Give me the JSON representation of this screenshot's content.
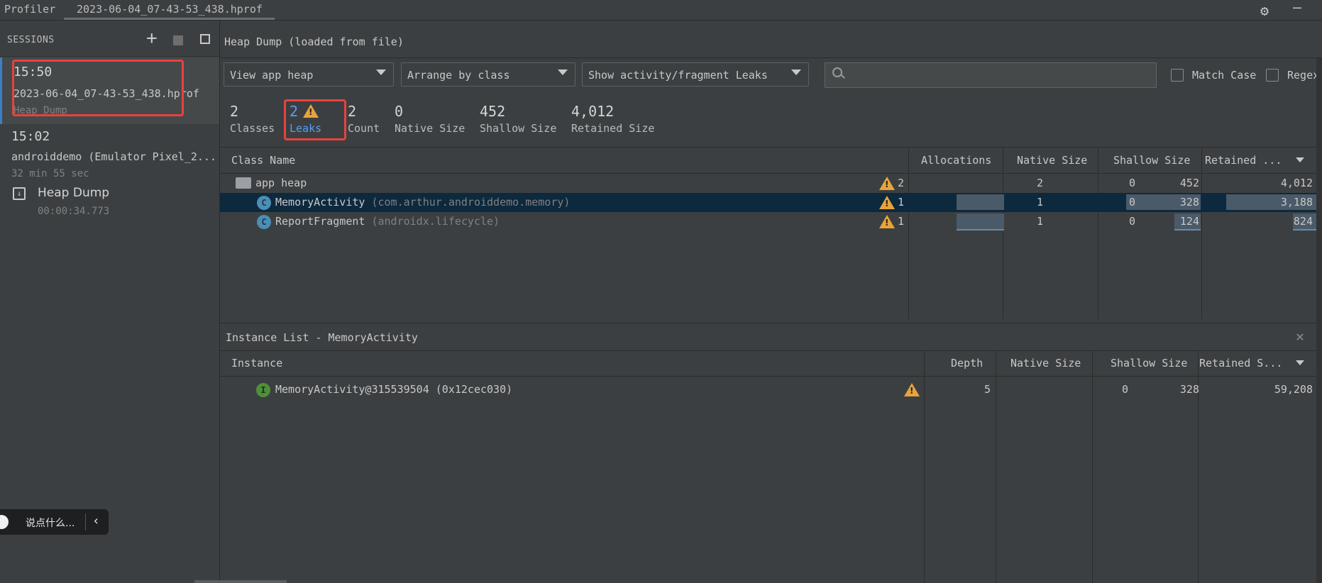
{
  "top_tabs": [
    "Profiler",
    "2023-06-04_07-43-53_438.hprof"
  ],
  "sessions": {
    "title": "SESSIONS",
    "items": [
      {
        "time": "15:50",
        "name": "2023-06-04_07-43-53_438.hprof",
        "type": "Heap Dump"
      },
      {
        "time": "15:02",
        "name": "androiddemo (Emulator Pixel_2...",
        "duration": "32 min 55 sec",
        "artifact": {
          "label": "Heap Dump",
          "time": "00:00:34.773"
        }
      }
    ]
  },
  "chat_pill": {
    "label": "说点什么..."
  },
  "main": {
    "title": "Heap Dump (loaded from file)",
    "dropdowns": {
      "heap": "View app heap",
      "arrange": "Arrange by class",
      "filter": "Show activity/fragment Leaks"
    },
    "search": {
      "placeholder": ""
    },
    "match_case": "Match Case",
    "regex": "Regex"
  },
  "stats": [
    {
      "value": "2",
      "label": "Classes"
    },
    {
      "value": "2",
      "label": "Leaks"
    },
    {
      "value": "2",
      "label": "Count"
    },
    {
      "value": "0",
      "label": "Native Size"
    },
    {
      "value": "452",
      "label": "Shallow Size"
    },
    {
      "value": "4,012",
      "label": "Retained Size"
    }
  ],
  "class_table": {
    "columns": [
      "Class Name",
      "Allocations",
      "Native Size",
      "Shallow Size",
      "Retained ..."
    ],
    "rows": [
      {
        "name": "app heap",
        "package": "",
        "leaks": "2",
        "allocations": "2",
        "native": "0",
        "shallow": "452",
        "retained": "4,012",
        "icon": "folder-icon"
      },
      {
        "name": "MemoryActivity",
        "package": "(com.arthur.androiddemo.memory)",
        "leaks": "1",
        "allocations": "1",
        "native": "0",
        "shallow": "328",
        "retained": "3,188",
        "icon": "class-icon"
      },
      {
        "name": "ReportFragment",
        "package": "(androidx.lifecycle)",
        "leaks": "1",
        "allocations": "1",
        "native": "0",
        "shallow": "124",
        "retained": "824",
        "icon": "class-icon"
      }
    ]
  },
  "instance_list": {
    "title": "Instance List - MemoryActivity",
    "columns": [
      "Instance",
      "Depth",
      "Native Size",
      "Shallow Size",
      "Retained S..."
    ],
    "rows": [
      {
        "name": "MemoryActivity@315539504 (0x12cec030)",
        "depth": "5",
        "native": "0",
        "shallow": "328",
        "retained": "59,208"
      }
    ]
  },
  "colors": {
    "accent": "#3f7ec7",
    "highlight": "#e8423e",
    "warning": "#e8a33a",
    "selected_row": "#0d293e"
  }
}
